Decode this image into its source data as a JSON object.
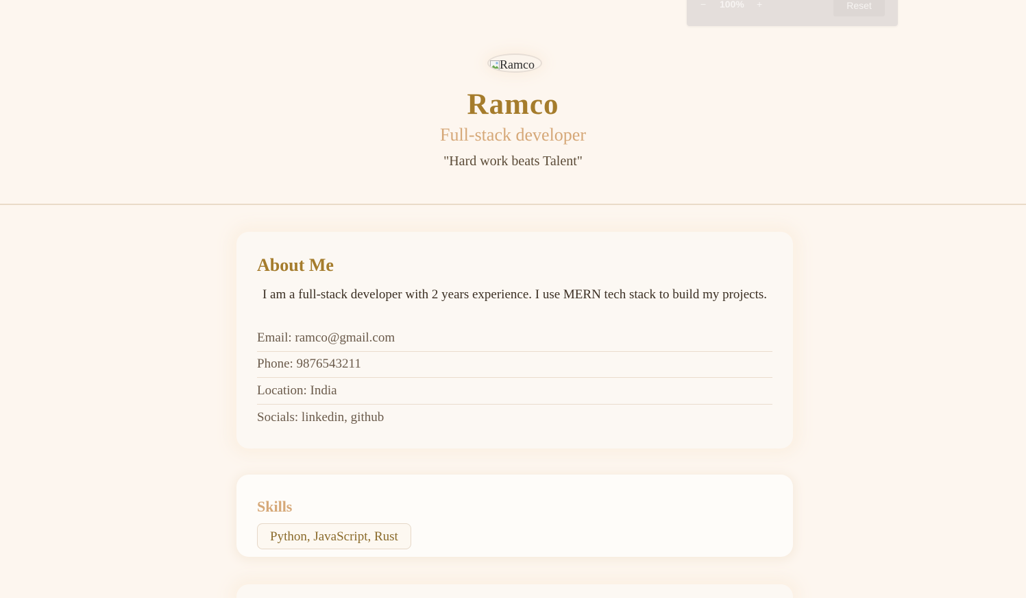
{
  "zoom_bar": {
    "minus_label": "−",
    "level": "100%",
    "plus_label": "+",
    "reset_label": "Reset"
  },
  "profile": {
    "avatar_alt": "Ramco",
    "name": "Ramco",
    "role": "Full-stack developer",
    "quote": "\"Hard work beats Talent\""
  },
  "about": {
    "heading": "About Me",
    "bio": "I am a full-stack developer with 2 years experience. I use MERN tech stack to build my projects.",
    "email": "Email: ramco@gmail.com",
    "phone": "Phone: 9876543211",
    "location": "Location: India",
    "socials": "Socials: linkedin, github"
  },
  "skills": {
    "heading": "Skills",
    "tag": "Python, JavaScript, Rust"
  },
  "colors": {
    "background": "#fdf6ef",
    "accent": "#a57c2c",
    "soft_accent": "#d6a878"
  }
}
